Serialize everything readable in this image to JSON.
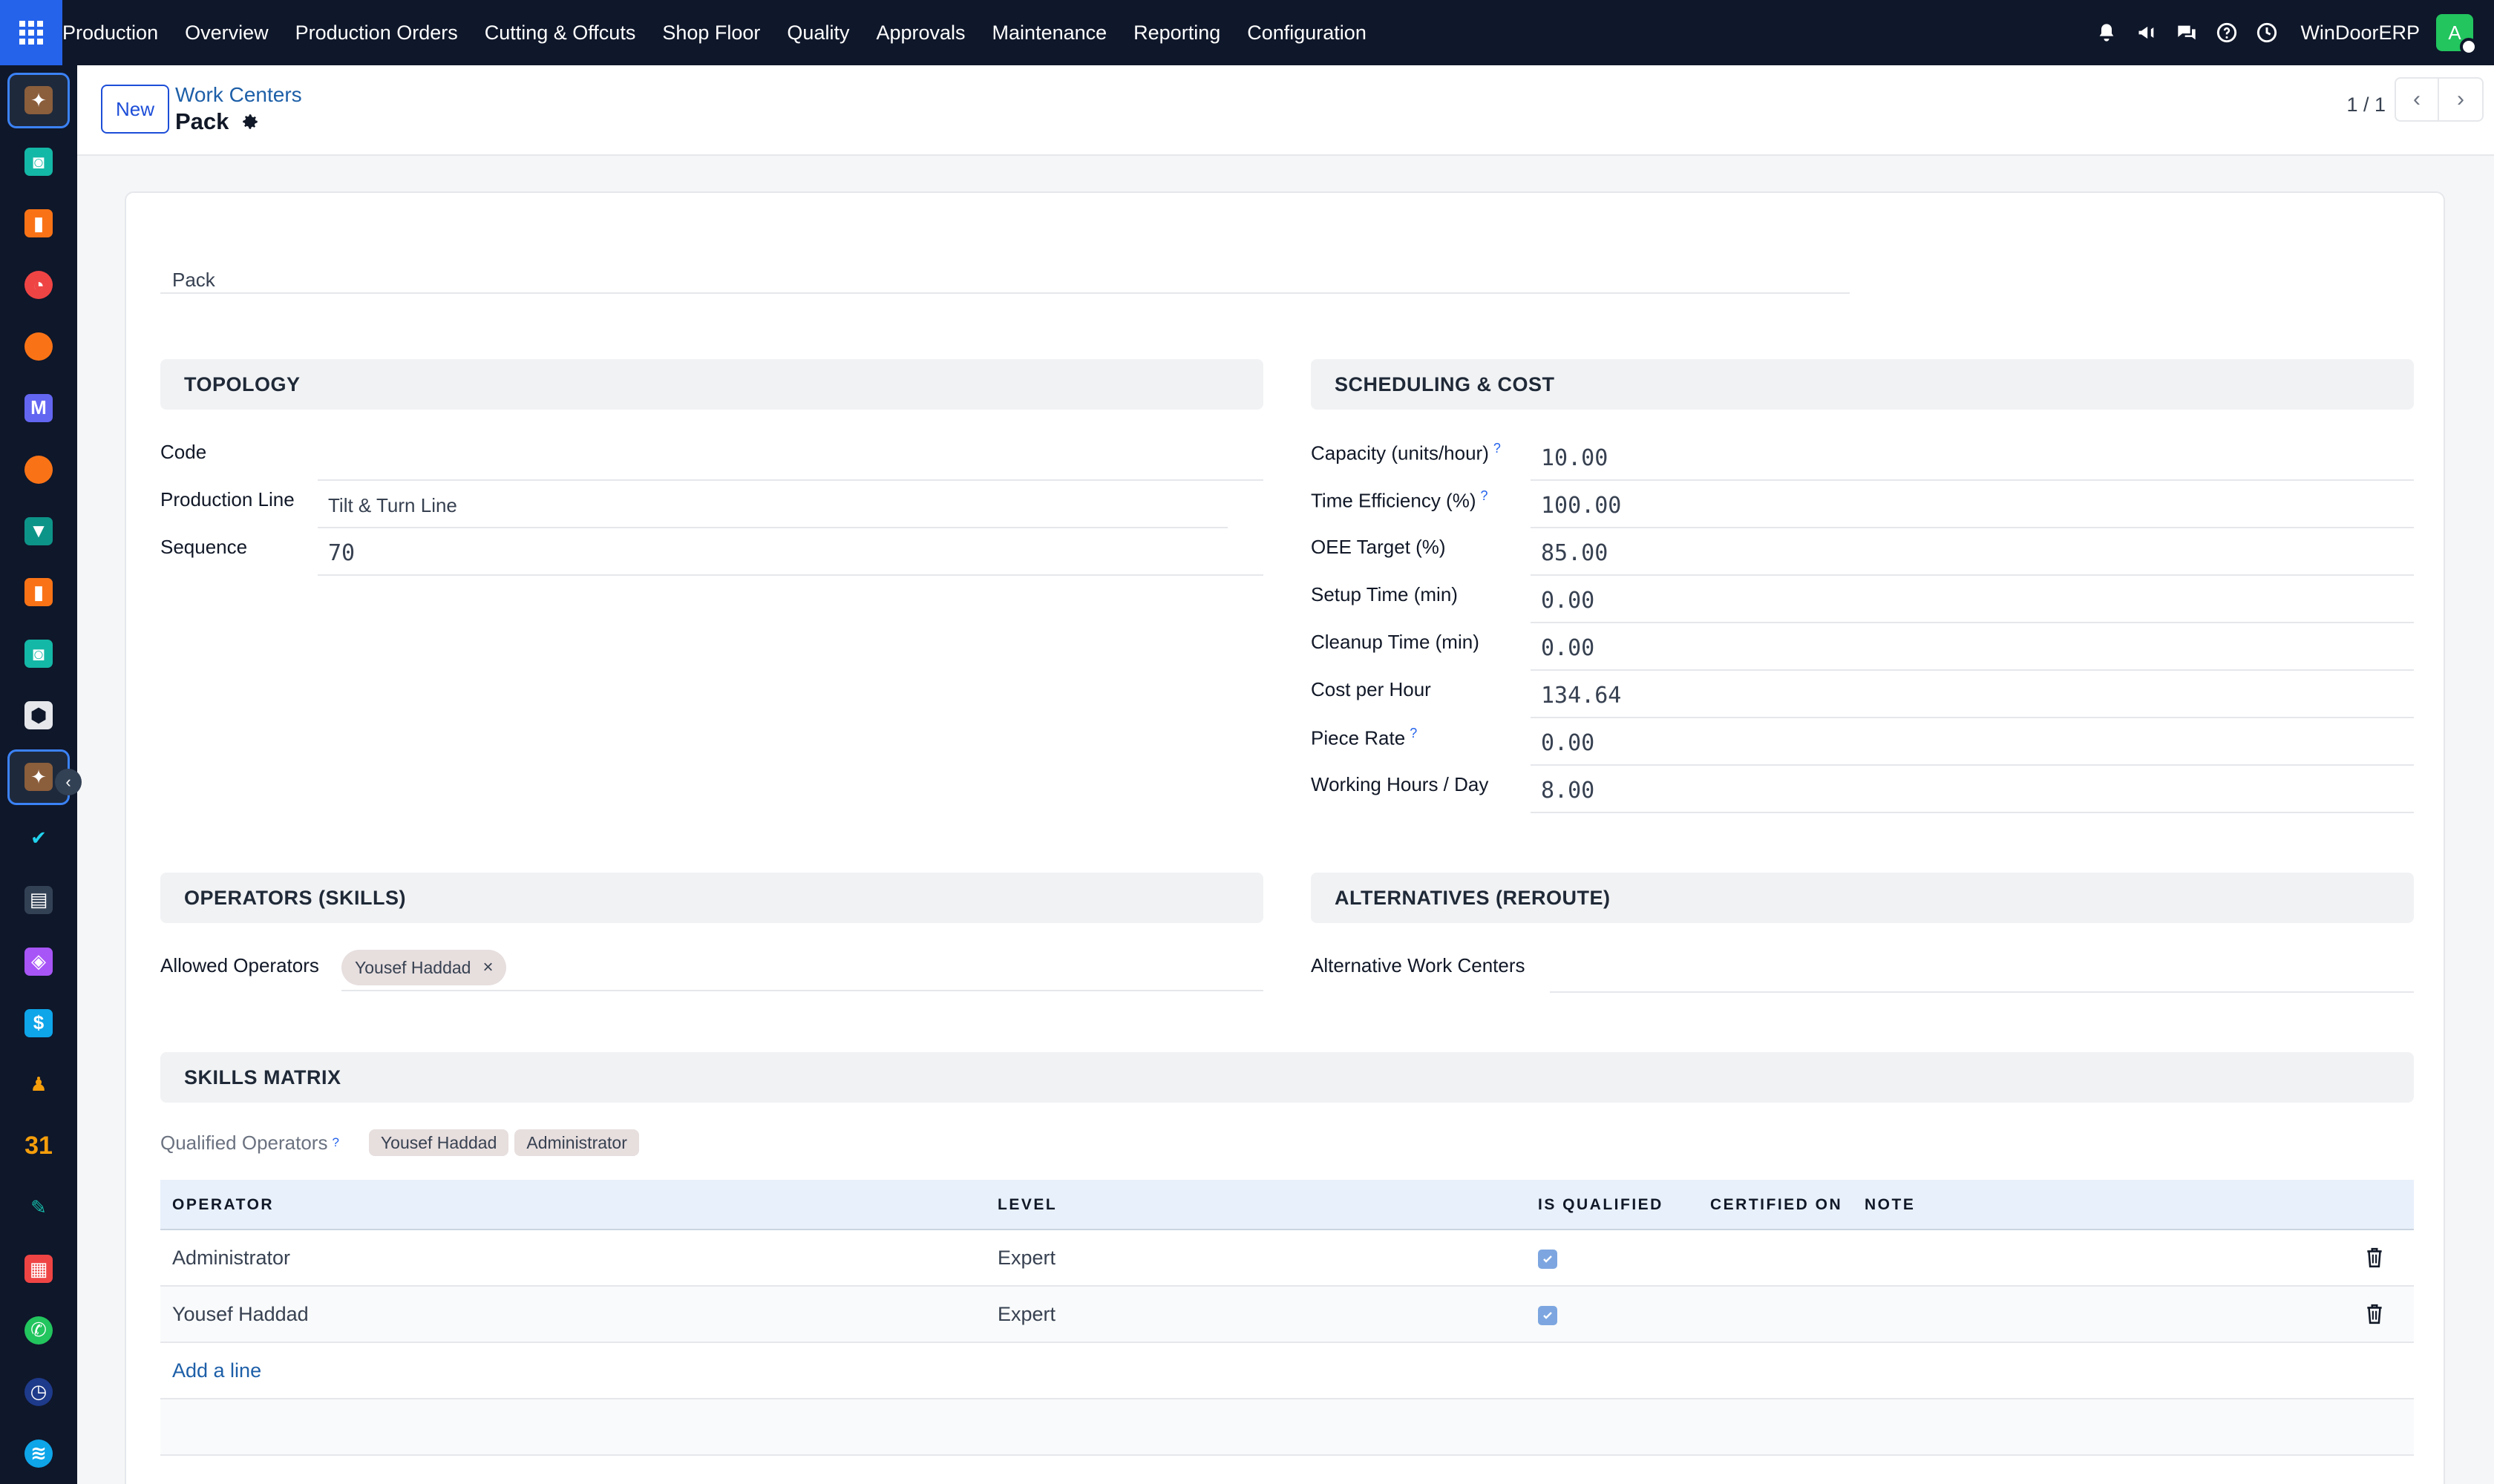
{
  "topnav": {
    "menu": [
      "Production",
      "Overview",
      "Production Orders",
      "Cutting & Offcuts",
      "Shop Floor",
      "Quality",
      "Approvals",
      "Maintenance",
      "Reporting",
      "Configuration"
    ],
    "company": "WinDoorERP",
    "avatar_initial": "A"
  },
  "control": {
    "new_label": "New",
    "breadcrumb": "Work Centers",
    "record_title": "Pack",
    "pager": "1 / 1"
  },
  "form": {
    "name": "Pack",
    "topology": {
      "heading": "TOPOLOGY",
      "code_label": "Code",
      "code_value": "",
      "line_label": "Production Line",
      "line_value": "Tilt & Turn Line",
      "sequence_label": "Sequence",
      "sequence_value": "70"
    },
    "scheduling": {
      "heading": "SCHEDULING & COST",
      "fields": [
        {
          "label": "Capacity (units/hour)",
          "help": "?",
          "value": "10.00"
        },
        {
          "label": "Time Efficiency (%)",
          "help": "?",
          "value": "100.00"
        },
        {
          "label": "OEE Target (%)",
          "help": "",
          "value": "85.00"
        },
        {
          "label": "Setup Time (min)",
          "help": "",
          "value": "0.00"
        },
        {
          "label": "Cleanup Time (min)",
          "help": "",
          "value": "0.00"
        },
        {
          "label": "Cost per Hour",
          "help": "",
          "value": "134.64"
        },
        {
          "label": "Piece Rate",
          "help": "?",
          "value": "0.00"
        },
        {
          "label": "Working Hours / Day",
          "help": "",
          "value": "8.00"
        }
      ]
    },
    "operators": {
      "heading": "OPERATORS (SKILLS)",
      "allowed_label": "Allowed Operators",
      "allowed_tag": "Yousef Haddad",
      "remove_glyph": "×"
    },
    "alternatives": {
      "heading": "ALTERNATIVES (REROUTE)",
      "label": "Alternative Work Centers"
    },
    "skills": {
      "heading": "SKILLS MATRIX",
      "qualified_label": "Qualified Operators",
      "help": "?",
      "qualified_tags": [
        "Yousef Haddad",
        "Administrator"
      ],
      "columns": [
        "OPERATOR",
        "LEVEL",
        "IS QUALIFIED",
        "CERTIFIED ON",
        "NOTE"
      ],
      "rows": [
        {
          "operator": "Administrator",
          "level": "Expert",
          "qualified": true,
          "certified": "",
          "note": ""
        },
        {
          "operator": "Yousef Haddad",
          "level": "Expert",
          "qualified": true,
          "certified": "",
          "note": ""
        }
      ],
      "add_line": "Add a line"
    }
  },
  "colors": {
    "nav_bg": "#0f172a",
    "accent": "#1d5fa8",
    "apps_button": "#2563eb",
    "avatar": "#22c55e",
    "table_header": "#e8f0fb"
  },
  "sidebar_icons": [
    "manufacturing-icon",
    "contacts-icon",
    "reporting-icon",
    "pie-icon",
    "discuss-icon",
    "mail-icon",
    "chat-icon",
    "project-icon",
    "reporting-icon-2",
    "contacts-icon-2",
    "inventory-icon",
    "manufacturing-active-icon",
    "check-icon",
    "knowledge-icon",
    "package-icon",
    "invoice-icon",
    "employees-icon",
    "calendar-icon",
    "sign-icon",
    "dashboard-icon",
    "whatsapp-icon",
    "clock-icon",
    "swirl-icon"
  ]
}
